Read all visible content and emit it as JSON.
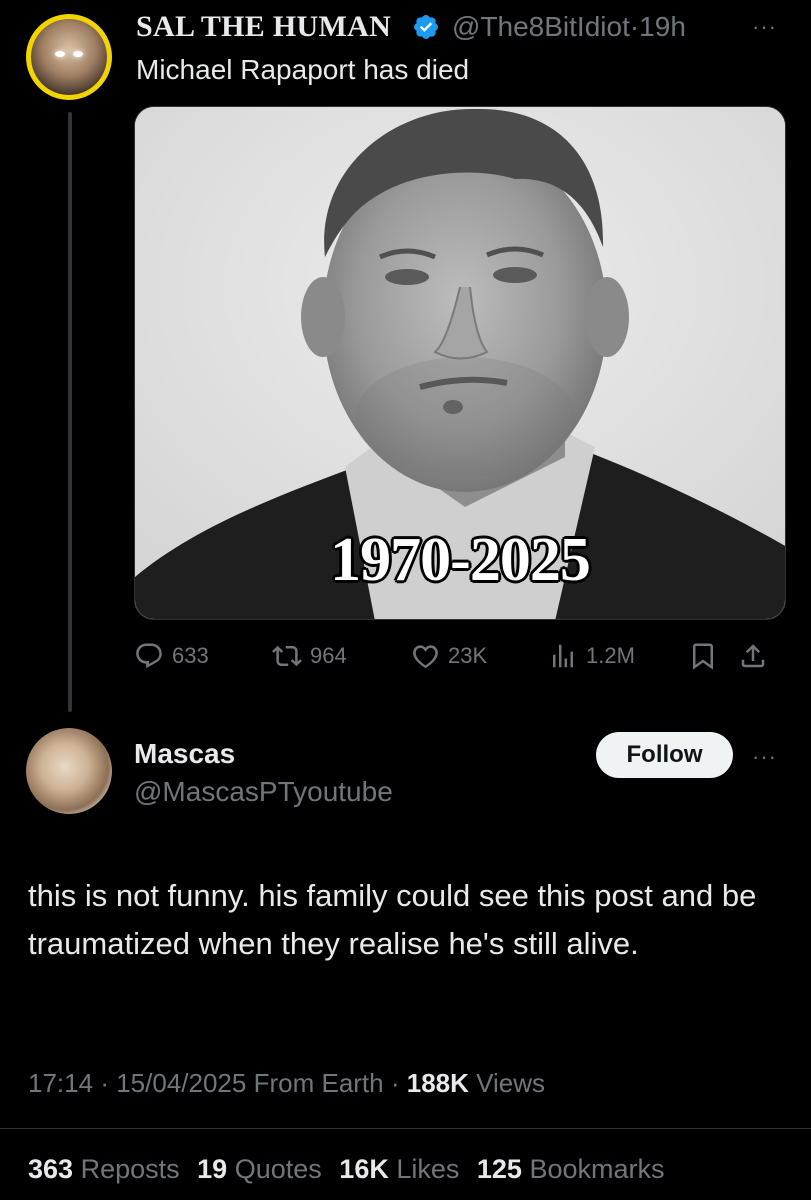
{
  "tweet": {
    "display_name": "SAL THE HUMAN",
    "handle": "@The8BitIdiot",
    "separator": "·",
    "time": "19h",
    "more": "···",
    "text": "Michael Rapaport has died",
    "image_caption": "1970-2025",
    "stats": {
      "replies": "633",
      "reposts": "964",
      "likes": "23K",
      "views": "1.2M"
    },
    "icons": [
      "verified-badge-icon",
      "reply-icon",
      "repost-icon",
      "like-icon",
      "views-icon",
      "bookmark-icon",
      "share-icon"
    ],
    "verified_color": "#1d9bf0"
  },
  "reply": {
    "display_name": "Mascas",
    "handle": "@MascasPTyoutube",
    "follow_label": "Follow",
    "more": "···",
    "text": "this is not funny. his family could see this post and be traumatized when they realise he's still alive.",
    "time": "17:14",
    "date": "15/04/2025",
    "source": "From Earth",
    "dot": "·",
    "views_count": "188K",
    "views_label": "Views",
    "stats": {
      "reposts_count": "363",
      "reposts_label": "Reposts",
      "quotes_count": "19",
      "quotes_label": "Quotes",
      "likes_count": "16K",
      "likes_label": "Likes",
      "bookmarks_count": "125",
      "bookmarks_label": "Bookmarks"
    }
  },
  "colors": {
    "background": "#000000",
    "text": "#e7e9ea",
    "muted": "#71767b",
    "avatar_ring": "#f1d400"
  }
}
